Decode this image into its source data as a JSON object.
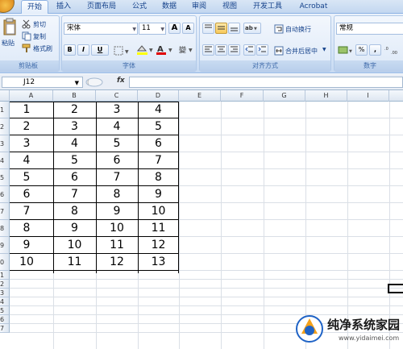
{
  "tabs": [
    "开始",
    "插入",
    "页面布局",
    "公式",
    "数据",
    "审阅",
    "视图",
    "开发工具",
    "Acrobat"
  ],
  "ribbon": {
    "clipboard": {
      "paste": "粘贴",
      "cut": "剪切",
      "copy": "复制",
      "format_painter": "格式刷",
      "caption": "剪贴板"
    },
    "font": {
      "name": "宋体",
      "size": "11",
      "caption": "字体",
      "bold": "B",
      "italic": "I",
      "underline": "U",
      "grow": "A",
      "shrink": "A"
    },
    "alignment": {
      "wrap_text": "自动换行",
      "merge_center": "合并后居中",
      "caption": "对齐方式"
    },
    "number": {
      "format": "常规",
      "percent": "%",
      "comma": ",",
      "caption": "数字"
    }
  },
  "formula_bar": {
    "name_box": "J12",
    "fx": "fx",
    "formula": ""
  },
  "columns": [
    "A",
    "B",
    "C",
    "D",
    "E",
    "F",
    "G",
    "H",
    "I"
  ],
  "rows": [
    "1",
    "2",
    "3",
    "4",
    "5",
    "6",
    "7",
    "8",
    "9",
    "0",
    "1",
    "2",
    "3",
    "4",
    "5",
    "6",
    "7"
  ],
  "cells": [
    [
      "1",
      "2",
      "3",
      "4"
    ],
    [
      "2",
      "3",
      "4",
      "5"
    ],
    [
      "3",
      "4",
      "5",
      "6"
    ],
    [
      "4",
      "5",
      "6",
      "7"
    ],
    [
      "5",
      "6",
      "7",
      "8"
    ],
    [
      "6",
      "7",
      "8",
      "9"
    ],
    [
      "7",
      "8",
      "9",
      "10"
    ],
    [
      "8",
      "9",
      "10",
      "11"
    ],
    [
      "9",
      "10",
      "11",
      "12"
    ],
    [
      "10",
      "11",
      "12",
      "13"
    ]
  ],
  "watermark": {
    "title": "纯净系统家园",
    "url": "www.yidaimei.com"
  }
}
